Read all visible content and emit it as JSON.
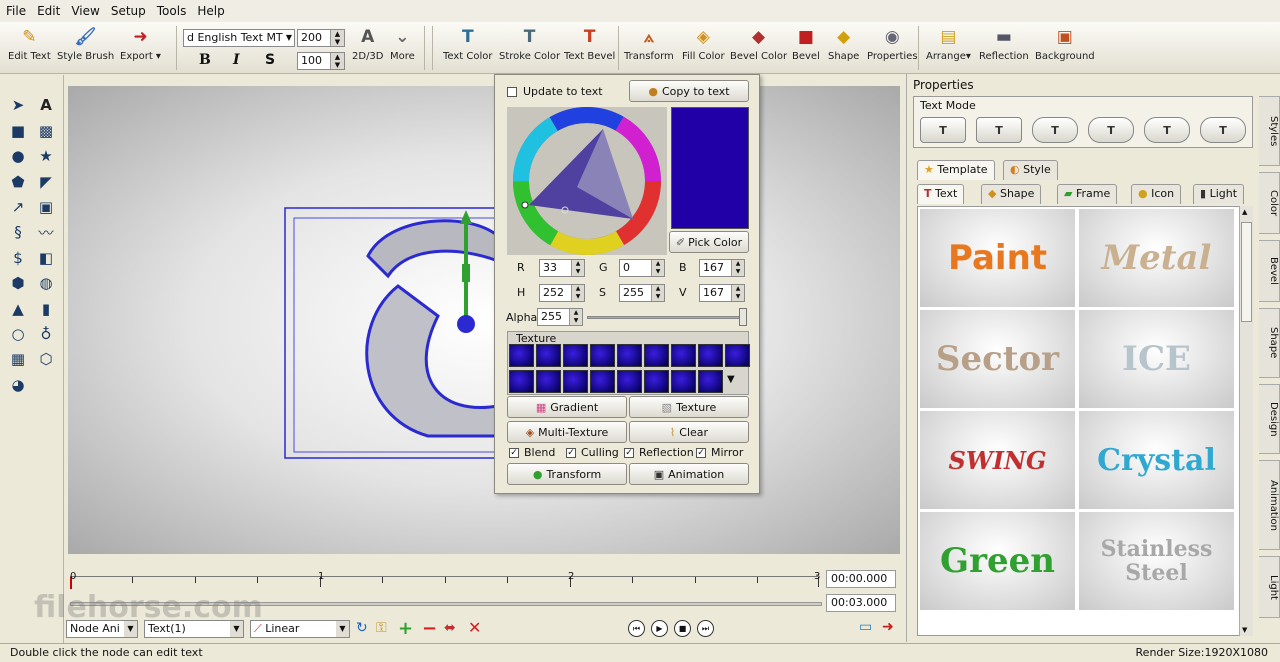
{
  "menu": [
    "File",
    "Edit",
    "View",
    "Setup",
    "Tools",
    "Help"
  ],
  "toolbar": {
    "edit_text": "Edit Text",
    "style_brush": "Style Brush",
    "export": "Export",
    "font_name": "d English Text MT",
    "size_a": "200",
    "size_b": "100",
    "bold": "B",
    "italic": "I",
    "strike": "S",
    "mode_2d3d": "2D/3D",
    "more": "More",
    "text_color": "Text Color",
    "stroke_color": "Stroke Color",
    "text_bevel": "Text Bevel",
    "transform": "Transform",
    "fill_color": "Fill Color",
    "bevel_color": "Bevel Color",
    "bevel": "Bevel",
    "shape": "Shape",
    "properties": "Properties",
    "arrange": "Arrange",
    "reflection": "Reflection",
    "background": "Background"
  },
  "color_popup": {
    "update_to_text": "Update to text",
    "copy_to_text": "Copy to text",
    "pick_color": "Pick Color",
    "current_color": "#2100a7",
    "r_label": "R",
    "r": "33",
    "g_label": "G",
    "g": "0",
    "b_label": "B",
    "b": "167",
    "h_label": "H",
    "h": "252",
    "s_label": "S",
    "s": "255",
    "v_label": "V",
    "v": "167",
    "alpha_label": "Alpha",
    "alpha": "255",
    "texture_label": "Texture",
    "gradient": "Gradient",
    "texture": "Texture",
    "multi_texture": "Multi-Texture",
    "clear": "Clear",
    "blend": "Blend",
    "culling": "Culling",
    "reflection": "Reflection",
    "mirror": "Mirror",
    "transform": "Transform",
    "animation": "Animation"
  },
  "timeline": {
    "ticks": [
      "0",
      "1",
      "2",
      "3"
    ],
    "time_current": "00:00.000",
    "time_total": "00:03.000"
  },
  "bottom": {
    "node_combo": "Node Ani",
    "text_combo": "Text(1)",
    "interp_combo": "Linear"
  },
  "watermark": "filehorse.com",
  "properties": {
    "title": "Properties",
    "text_mode": "Text Mode",
    "tab_template": "Template",
    "tab_style": "Style",
    "sub_text": "Text",
    "sub_shape": "Shape",
    "sub_frame": "Frame",
    "sub_icon": "Icon",
    "sub_light": "Light",
    "gallery": [
      "Paint",
      "Metal",
      "Sector",
      "ICE",
      "SWING",
      "Crystal",
      "Green",
      "Stainless Steel"
    ]
  },
  "side_tabs": [
    "Styles",
    "Color",
    "Bevel",
    "Shape",
    "Design",
    "Animation",
    "Light"
  ],
  "status": {
    "hint": "Double click the node can edit text",
    "render_size": "Render Size:1920X1080"
  }
}
